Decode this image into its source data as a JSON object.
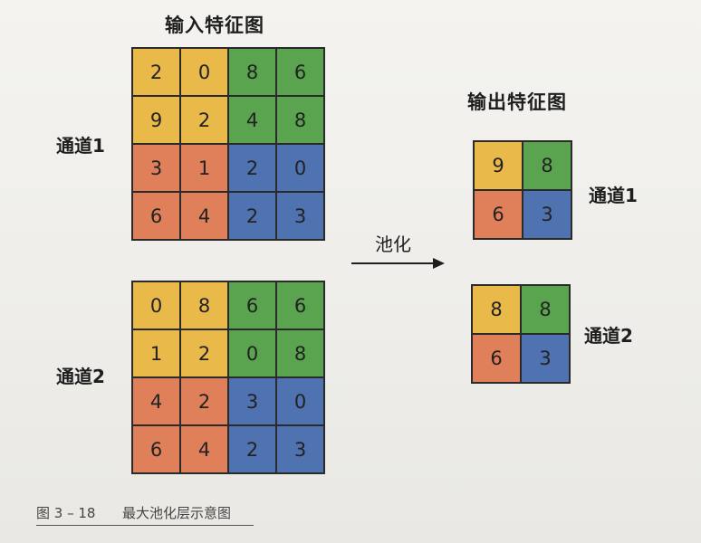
{
  "input_title": "输入特征图",
  "output_title": "输出特征图",
  "pool_label": "池化",
  "caption": {
    "number": "图 3 – 18",
    "text": "最大池化层示意图"
  },
  "colors": {
    "yellow": "#e9b94a",
    "green": "#5aa44f",
    "orange": "#e0805a",
    "blue": "#4f72b0"
  },
  "input": [
    {
      "label": "通道1",
      "values": [
        [
          2,
          0,
          8,
          6
        ],
        [
          9,
          2,
          4,
          8
        ],
        [
          3,
          1,
          2,
          0
        ],
        [
          6,
          4,
          2,
          3
        ]
      ]
    },
    {
      "label": "通道2",
      "values": [
        [
          0,
          8,
          6,
          6
        ],
        [
          1,
          2,
          0,
          8
        ],
        [
          4,
          2,
          3,
          0
        ],
        [
          6,
          4,
          2,
          3
        ]
      ]
    }
  ],
  "output": [
    {
      "label": "通道1",
      "values": [
        [
          9,
          8
        ],
        [
          6,
          3
        ]
      ]
    },
    {
      "label": "通道2",
      "values": [
        [
          8,
          8
        ],
        [
          6,
          3
        ]
      ]
    }
  ]
}
